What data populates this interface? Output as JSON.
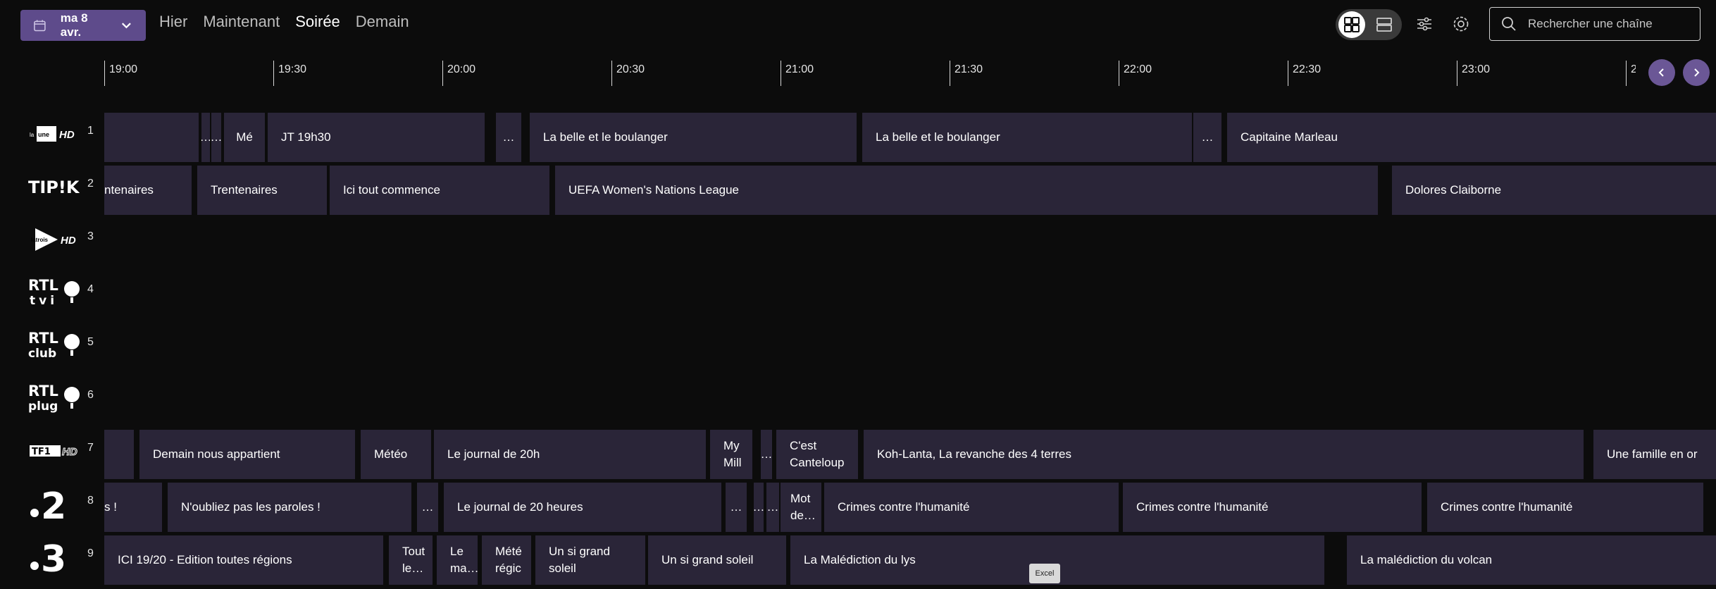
{
  "header": {
    "date_label": "ma 8 avr.",
    "nav": [
      "Hier",
      "Maintenant",
      "Soirée",
      "Demain"
    ],
    "active_nav": "Soirée",
    "search_placeholder": "Rechercher une chaîne"
  },
  "icons": {
    "date": "calendar-icon",
    "date_dropdown": "chevron-down-icon",
    "grid_view": "grid-view-icon",
    "list_view": "list-view-icon",
    "filters": "filters-icon",
    "settings": "gear-icon",
    "search": "search-icon",
    "prev": "chevron-left-icon",
    "next": "chevron-right-icon"
  },
  "colors": {
    "accent": "#5e4b8b",
    "program_bg": "#2a2538",
    "page_bg": "#0c0c0c"
  },
  "timeline": [
    "19:00",
    "19:30",
    "20:00",
    "20:30",
    "21:00",
    "21:30",
    "22:00",
    "22:30",
    "23:00",
    "2"
  ],
  "channels": [
    {
      "number": "1",
      "logo": "La Une HD"
    },
    {
      "number": "2",
      "logo": "TIPIK"
    },
    {
      "number": "3",
      "logo": "La Trois HD"
    },
    {
      "number": "4",
      "logo": "RTL tvi"
    },
    {
      "number": "5",
      "logo": "RTL club"
    },
    {
      "number": "6",
      "logo": "RTL plug"
    },
    {
      "number": "7",
      "logo": "TF1 HD"
    },
    {
      "number": "8",
      "logo": "•2"
    },
    {
      "number": "9",
      "logo": "•3"
    }
  ],
  "programs": {
    "ch1": [
      "",
      "…",
      "…",
      "Mé",
      "JT 19h30",
      "…",
      "La belle et le boulanger",
      "La belle et le boulanger",
      "…",
      "Capitaine Marleau"
    ],
    "ch2": [
      "ntenaires",
      "Trentenaires",
      "Ici tout commence",
      "UEFA Women's Nations League",
      "Dolores Claiborne"
    ],
    "ch7": [
      "",
      "Demain nous appartient",
      "Météo",
      "Le journal de 20h",
      "My Mill",
      "…",
      "C'est Canteloup",
      "Koh-Lanta, La revanche des 4 terres",
      "Une famille en or"
    ],
    "ch8": [
      "s !",
      "N'oubliez pas les paroles !",
      "…",
      "Le journal de 20 heures",
      "…",
      "…",
      "…",
      "Mot de…",
      "Crimes contre l'humanité",
      "Crimes contre l'humanité",
      "Crimes contre l'humanité"
    ],
    "ch9": [
      "ICI 19/20 - Edition toutes régions",
      "Tout le…",
      "Le ma…",
      "Mété régic",
      "Un si grand soleil",
      "Un si grand soleil",
      "La Malédiction du lys",
      "La malédiction du volcan"
    ]
  },
  "tooltip": "Excel"
}
